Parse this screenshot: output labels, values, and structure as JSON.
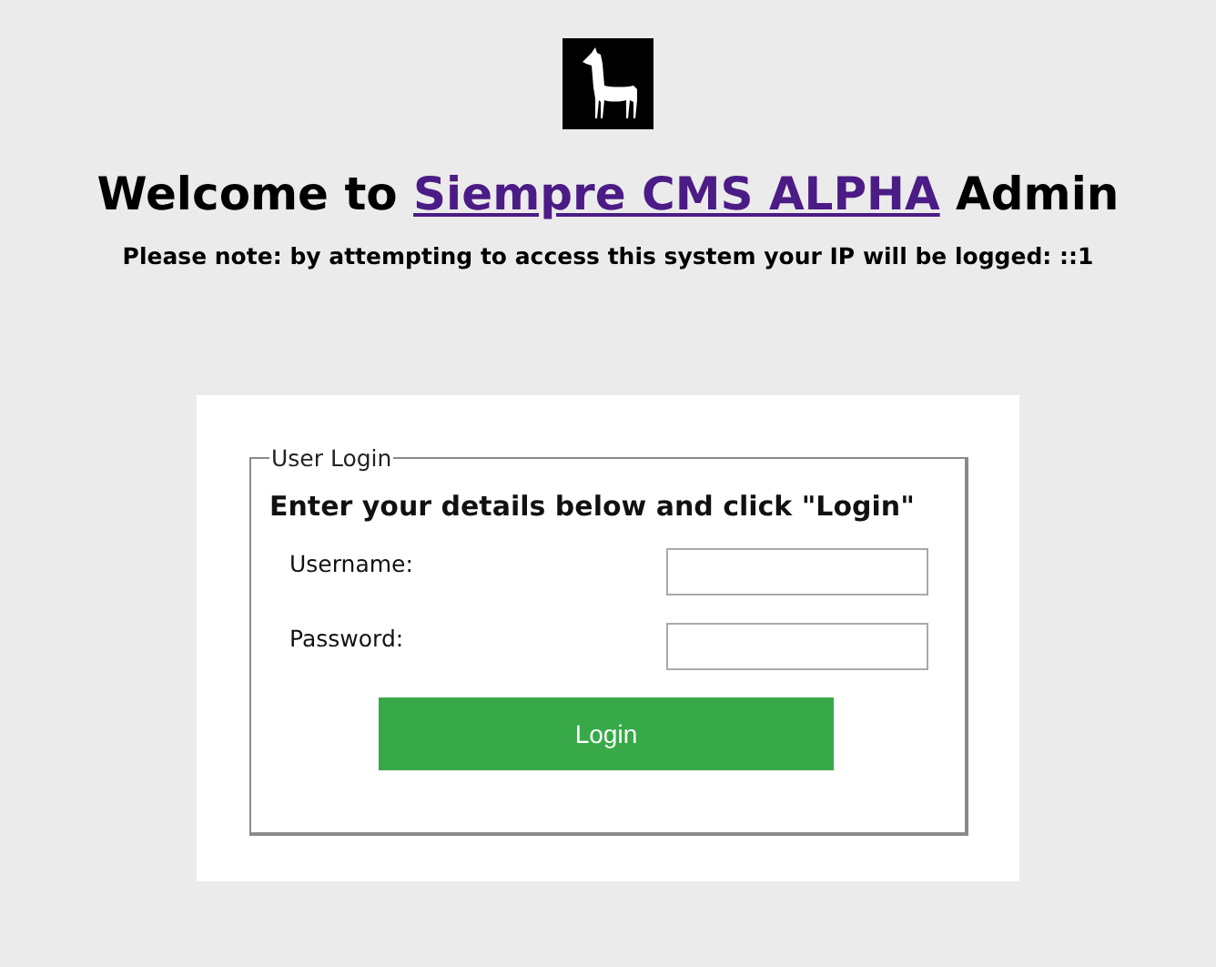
{
  "heading": {
    "prefix": "Welcome to",
    "link": "Siempre CMS ALPHA",
    "suffix": "Admin"
  },
  "notice": "Please note: by attempting to access this system your IP will be logged: ::1",
  "login": {
    "legend": "User Login",
    "instructions": "Enter your details below and click \"Login\"",
    "fields": [
      {
        "label": "Username:"
      },
      {
        "label": "Password:"
      }
    ],
    "button": "Login"
  }
}
